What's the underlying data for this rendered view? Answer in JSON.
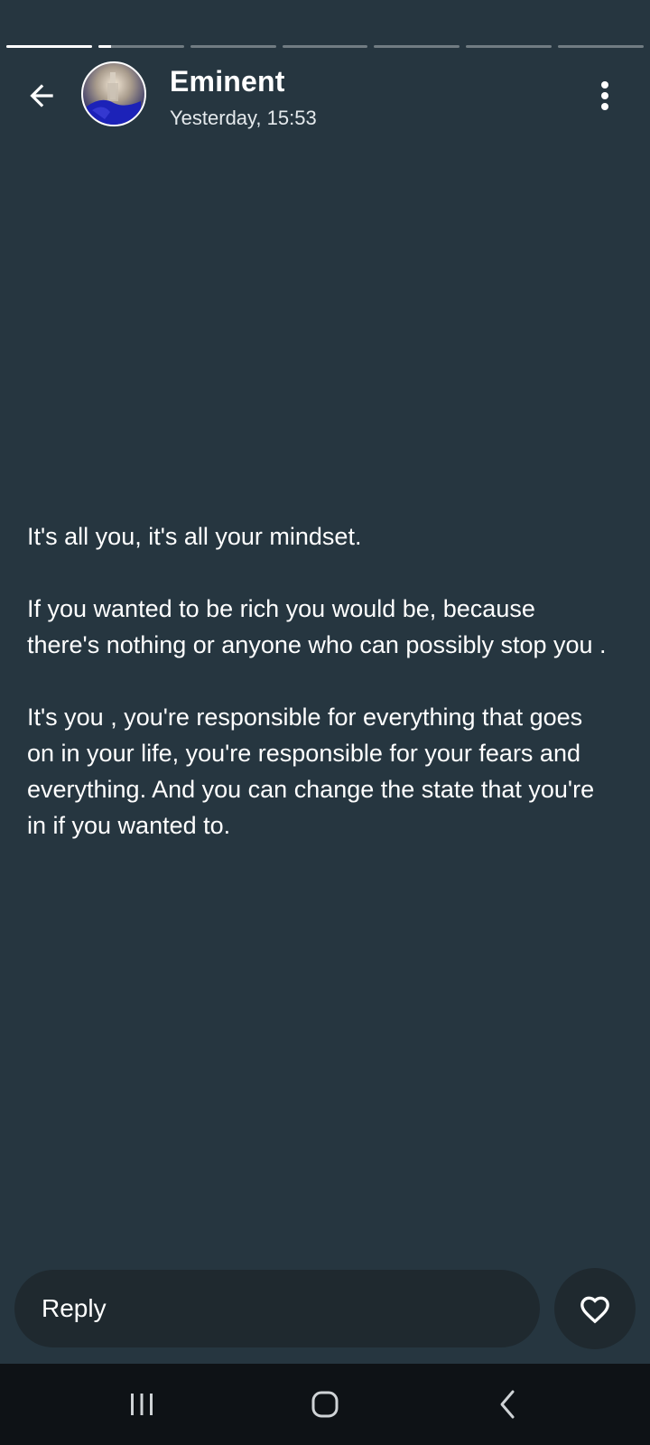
{
  "story": {
    "segments": [
      {
        "progress": 1.0
      },
      {
        "progress": 0.15
      },
      {
        "progress": 0.0
      },
      {
        "progress": 0.0
      },
      {
        "progress": 0.0
      },
      {
        "progress": 0.0
      },
      {
        "progress": 0.0
      }
    ],
    "paragraphs": [
      "It's all you, it's all your mindset.",
      "If you wanted to be rich you would be, because there's nothing or anyone who can possibly stop you .",
      "It's you , you're responsible for everything that goes on in your life, you're responsible for your fears and everything. And you can change the state that you're in if you wanted to."
    ]
  },
  "header": {
    "name": "Eminent",
    "timestamp": "Yesterday, 15:53",
    "back_icon": "arrow-left-icon",
    "menu_icon": "more-vertical-icon"
  },
  "reply": {
    "label": "Reply",
    "like_icon": "heart-outline-icon"
  },
  "navbar": {
    "recents_icon": "recents-icon",
    "home_icon": "home-icon",
    "back_icon": "nav-back-icon"
  },
  "colors": {
    "background": "#263640",
    "input_background": "#1f292f",
    "navbar_background": "#0e1216"
  }
}
